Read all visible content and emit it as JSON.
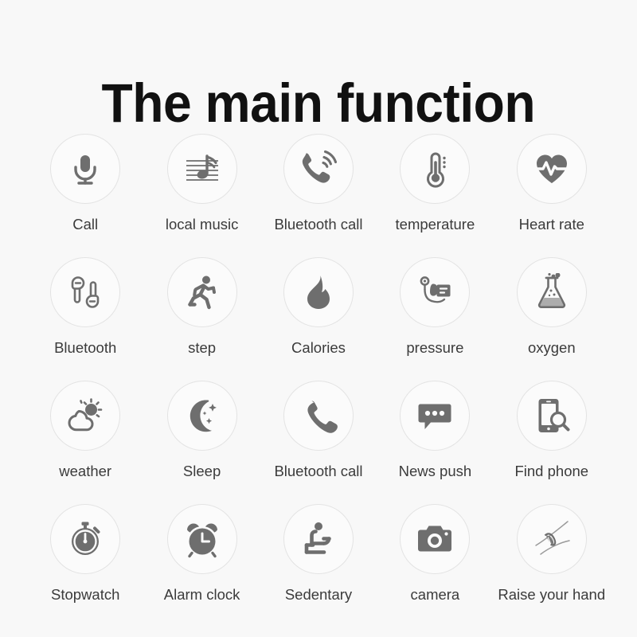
{
  "page": {
    "background_color": "#f8f8f8",
    "title": "The main function",
    "title_color": "#111111",
    "label_color": "#3b3b3b",
    "badge_border_color": "#e3e3e3",
    "icon_color": "#6e6e6e"
  },
  "grid": {
    "columns": 5,
    "rows": 4,
    "items": [
      {
        "label": "Call",
        "icon": "microphone-icon"
      },
      {
        "label": "local music",
        "icon": "music-note-staff-icon"
      },
      {
        "label": "Bluetooth call",
        "icon": "phone-ringing-icon"
      },
      {
        "label": "temperature",
        "icon": "thermometer-icon"
      },
      {
        "label": "Heart rate",
        "icon": "heart-pulse-icon"
      },
      {
        "label": "Bluetooth",
        "icon": "wireless-earbuds-icon"
      },
      {
        "label": "step",
        "icon": "running-person-icon"
      },
      {
        "label": "Calories",
        "icon": "flame-icon"
      },
      {
        "label": "pressure",
        "icon": "blood-pressure-monitor-icon"
      },
      {
        "label": "oxygen",
        "icon": "flask-bubbles-icon"
      },
      {
        "label": "weather",
        "icon": "sun-cloud-icon"
      },
      {
        "label": "Sleep",
        "icon": "moon-stars-icon"
      },
      {
        "label": "Bluetooth call",
        "icon": "phone-handset-icon"
      },
      {
        "label": "News push",
        "icon": "chat-bubble-dots-icon"
      },
      {
        "label": "Find phone",
        "icon": "phone-search-icon"
      },
      {
        "label": "Stopwatch",
        "icon": "stopwatch-icon"
      },
      {
        "label": "Alarm clock",
        "icon": "alarm-clock-icon"
      },
      {
        "label": "Sedentary",
        "icon": "seated-person-icon"
      },
      {
        "label": "camera",
        "icon": "camera-icon"
      },
      {
        "label": "Raise your hand",
        "icon": "wrist-watch-raise-icon"
      }
    ]
  }
}
